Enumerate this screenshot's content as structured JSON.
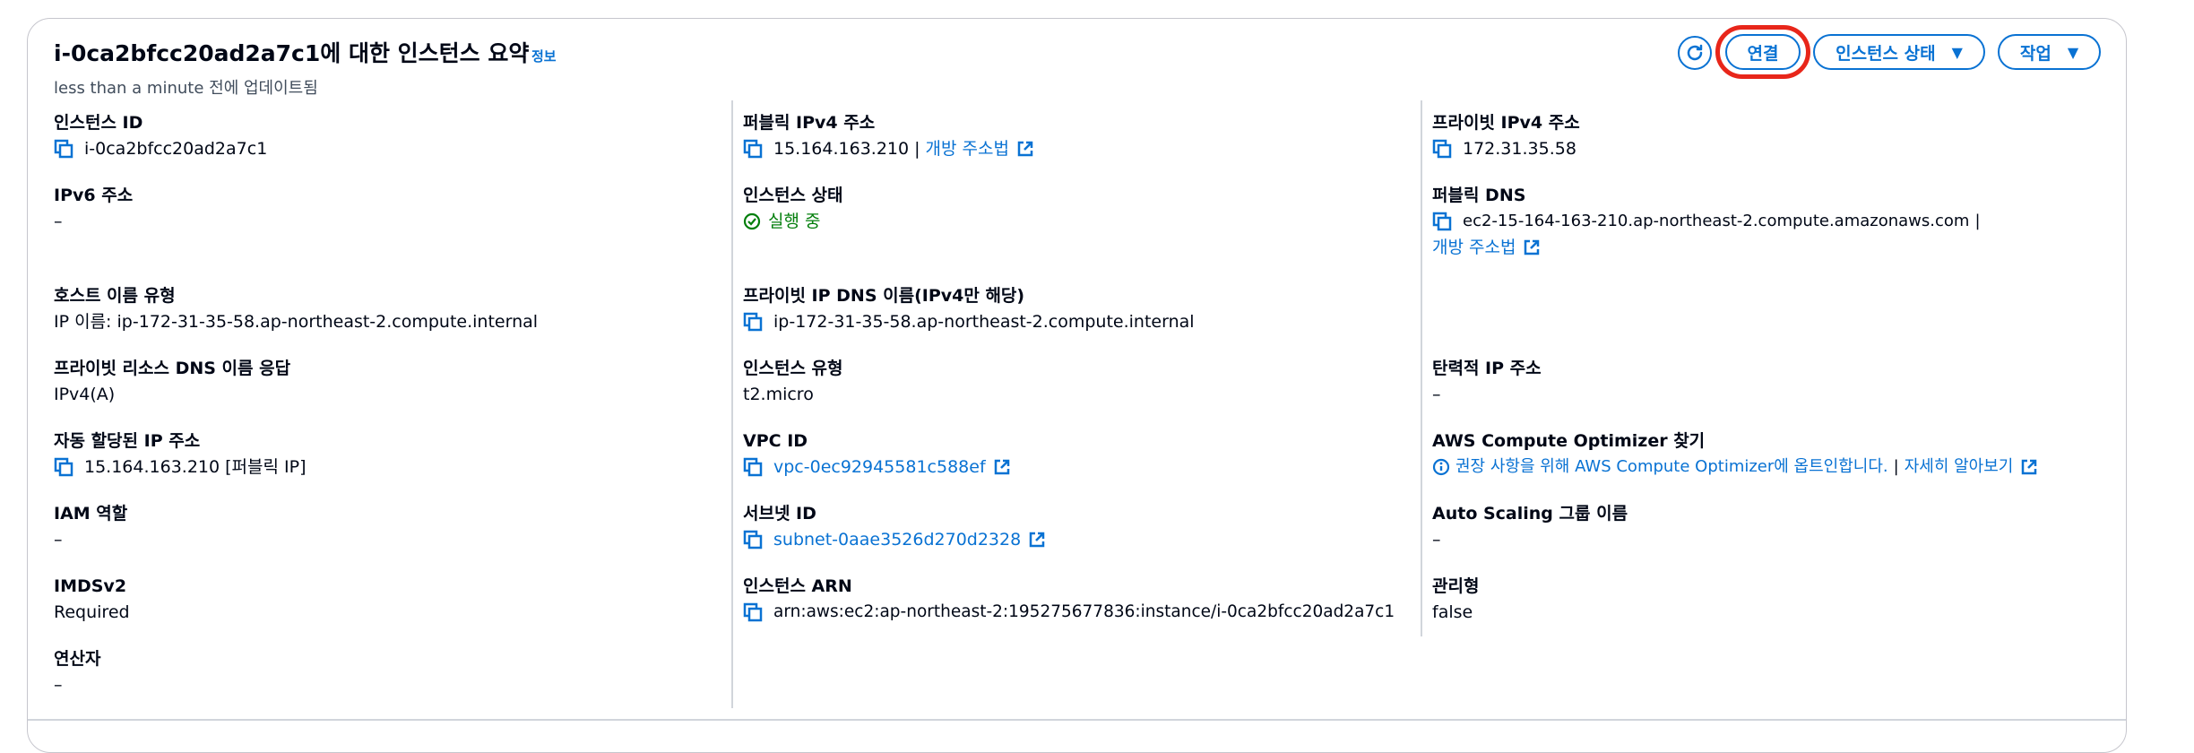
{
  "header": {
    "title": "i-0ca2bfcc20ad2a7c1에 대한 인스턴스 요약",
    "info_link": "정보",
    "subtitle": "less than a minute 전에 업데이트됨"
  },
  "actions": {
    "connect": "연결",
    "instance_state": "인스턴스 상태",
    "actions": "작업"
  },
  "col1": {
    "instance_id": {
      "label": "인스턴스 ID",
      "value": "i-0ca2bfcc20ad2a7c1"
    },
    "ipv6": {
      "label": "IPv6 주소",
      "value": "–"
    },
    "hostname_type": {
      "label": "호스트 이름 유형",
      "value": "IP 이름: ip-172-31-35-58.ap-northeast-2.compute.internal"
    },
    "private_dns_response": {
      "label": "프라이빗 리소스 DNS 이름 응답",
      "value": "IPv4(A)"
    },
    "auto_ip": {
      "label": "자동 할당된 IP 주소",
      "value": "15.164.163.210 [퍼블릭 IP]"
    },
    "iam_role": {
      "label": "IAM 역할",
      "value": "–"
    },
    "imdsv2": {
      "label": "IMDSv2",
      "value": "Required"
    },
    "operator": {
      "label": "연산자",
      "value": "–"
    }
  },
  "col2": {
    "public_ipv4": {
      "label": "퍼블릭 IPv4 주소",
      "value": "15.164.163.210",
      "sep": "|",
      "link": "개방 주소법"
    },
    "instance_state": {
      "label": "인스턴스 상태",
      "value": "실행 중"
    },
    "private_ip_dns": {
      "label": "프라이빗 IP DNS 이름(IPv4만 해당)",
      "value": "ip-172-31-35-58.ap-northeast-2.compute.internal"
    },
    "instance_type": {
      "label": "인스턴스 유형",
      "value": "t2.micro"
    },
    "vpc_id": {
      "label": "VPC ID",
      "value": "vpc-0ec92945581c588ef"
    },
    "subnet_id": {
      "label": "서브넷 ID",
      "value": "subnet-0aae3526d270d2328"
    },
    "instance_arn": {
      "label": "인스턴스 ARN",
      "value": "arn:aws:ec2:ap-northeast-2:195275677836:instance/i-0ca2bfcc20ad2a7c1"
    }
  },
  "col3": {
    "private_ipv4": {
      "label": "프라이빗 IPv4 주소",
      "value": "172.31.35.58"
    },
    "public_dns": {
      "label": "퍼블릭 DNS",
      "value": "ec2-15-164-163-210.ap-northeast-2.compute.amazonaws.com",
      "sep": "|",
      "link": "개방 주소법"
    },
    "elastic_ip": {
      "label": "탄력적 IP 주소",
      "value": "–"
    },
    "optimizer": {
      "label": "AWS Compute Optimizer 찾기",
      "value": "권장 사항을 위해 AWS Compute Optimizer에 옵트인합니다.",
      "sep": "|",
      "link": "자세히 알아보기"
    },
    "asg_name": {
      "label": "Auto Scaling 그룹 이름",
      "value": "–"
    },
    "managed": {
      "label": "관리형",
      "value": "false"
    }
  },
  "colors": {
    "link": "#0972d3",
    "success": "#037f0c",
    "highlight": "#e8261a",
    "border": "#c6c6cd"
  }
}
